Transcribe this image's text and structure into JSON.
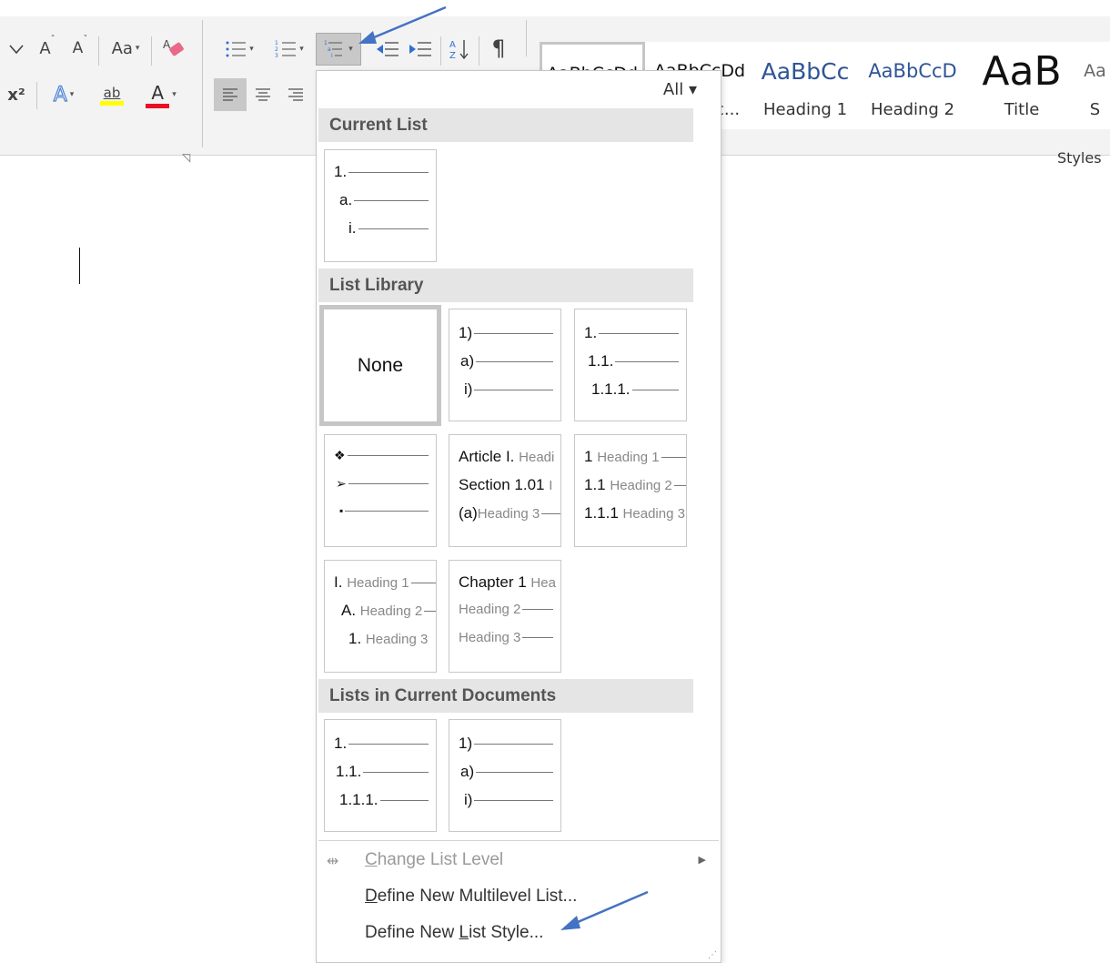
{
  "ribbon": {
    "font_case_label": "Aa",
    "superscript_label": "x²",
    "highlight_label": "ab",
    "font_color_label": "A",
    "styles_group_label": "Styles",
    "styles": [
      {
        "sample": "AaBbCcDd",
        "name": ""
      },
      {
        "sample": "AaBbCcDd",
        "name": "ac..."
      },
      {
        "sample": "AaBbCc",
        "name": "Heading 1"
      },
      {
        "sample": "AaBbCcD",
        "name": "Heading 2"
      },
      {
        "sample": "AaB",
        "name": "Title"
      },
      {
        "sample": "Aa",
        "name": "S"
      }
    ]
  },
  "dropdown": {
    "filter_label": "All ▾",
    "current_list_heading": "Current List",
    "list_library_heading": "List Library",
    "lists_in_docs_heading": "Lists in Current Documents",
    "current_tile": {
      "l1": "1.",
      "l2": "a.",
      "l3": "i."
    },
    "library": {
      "none": "None",
      "paren": {
        "l1": "1)",
        "l2": "a)",
        "l3": "i)"
      },
      "decimal": {
        "l1": "1.",
        "l2": "1.1.",
        "l3": "1.1.1."
      },
      "bullets": {
        "l1": "❖",
        "l2": "➢",
        "l3": "▪"
      },
      "article": {
        "l1a": "Article I.",
        "l1b": "Headi",
        "l2a": "Section 1.01",
        "l2b": "I",
        "l3a": "(a)",
        "l3b": "Heading 3"
      },
      "heading_num": {
        "l1a": "1",
        "l1b": "Heading 1",
        "l2a": "1.1",
        "l2b": "Heading 2",
        "l3a": "1.1.1",
        "l3b": "Heading 3"
      },
      "roman_heading": {
        "l1a": "I.",
        "l1b": "Heading 1",
        "l2a": "A.",
        "l2b": "Heading 2",
        "l3a": "1.",
        "l3b": "Heading 3"
      },
      "chapter": {
        "l1a": "Chapter 1",
        "l1b": "Hea",
        "l2b": "Heading 2",
        "l3b": "Heading 3"
      }
    },
    "docs": {
      "decimal": {
        "l1": "1.",
        "l2": "1.1.",
        "l3": "1.1.1."
      },
      "paren": {
        "l1": "1)",
        "l2": "a)",
        "l3": "i)"
      }
    },
    "menu": {
      "change_level": {
        "prefix": "",
        "key": "C",
        "rest": "hange List Level"
      },
      "define_multilevel": {
        "key": "D",
        "rest": "efine New Multilevel List..."
      },
      "define_style": {
        "pre": "Define New ",
        "key": "L",
        "rest": "ist Style..."
      }
    }
  },
  "colors": {
    "arrow": "#4472c4",
    "highlight_yellow": "#ffff00",
    "font_red": "#e81123",
    "heading_blue": "#2f5496"
  }
}
